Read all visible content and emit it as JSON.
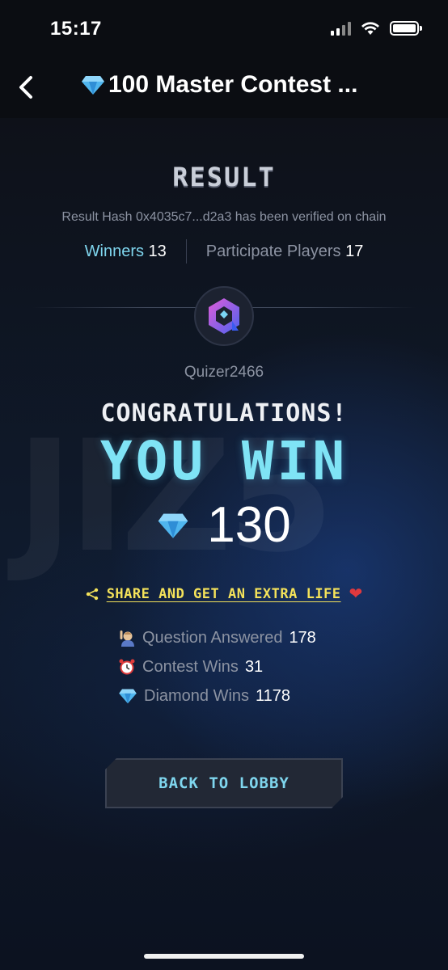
{
  "status_bar": {
    "time": "15:17"
  },
  "nav": {
    "title": "100 Master Contest ..."
  },
  "result": {
    "title": "RESULT",
    "hash_text": "Result Hash 0x4035c7...d2a3 has been verified on chain",
    "winners_label": "Winners",
    "winners_value": "13",
    "players_label": "Participate Players",
    "players_value": "17"
  },
  "user": {
    "username": "Quizer2466"
  },
  "win": {
    "congrats": "CONGRATULATIONS!",
    "headline": "YOU WIN",
    "amount": "130"
  },
  "share": {
    "label": "SHARE AND GET AN EXTRA LIFE"
  },
  "stats": [
    {
      "label": "Question Answered",
      "value": "178",
      "icon": "raising-hand-icon"
    },
    {
      "label": "Contest Wins",
      "value": "31",
      "icon": "alarm-clock-icon"
    },
    {
      "label": "Diamond Wins",
      "value": "1178",
      "icon": "diamond-icon"
    }
  ],
  "actions": {
    "back_to_lobby": "BACK TO LOBBY"
  },
  "colors": {
    "accent": "#7fd6ee",
    "share_yellow": "#f4e25a",
    "background": "#0c0f16"
  }
}
